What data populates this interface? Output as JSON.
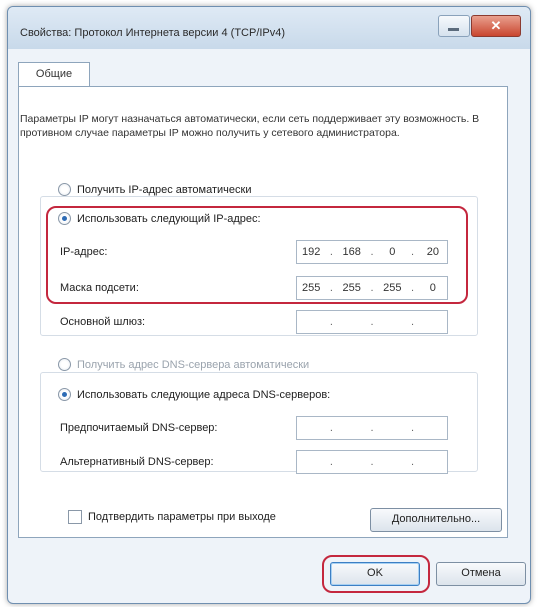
{
  "window": {
    "title": "Свойства: Протокол Интернета версии 4 (TCP/IPv4)",
    "close_glyph": "✕"
  },
  "tabs": [
    {
      "label": "Общие"
    }
  ],
  "description": "Параметры IP могут назначаться автоматически, если сеть поддерживает эту возможность. В противном случае параметры IP можно получить у сетевого администратора.",
  "ip_section": {
    "auto_label": "Получить IP-адрес автоматически",
    "manual_label": "Использовать следующий IP-адрес:",
    "ip_label": "IP-адрес:",
    "ip_value": [
      "192",
      "168",
      "0",
      "20"
    ],
    "mask_label": "Маска подсети:",
    "mask_value": [
      "255",
      "255",
      "255",
      "0"
    ],
    "gateway_label": "Основной шлюз:",
    "gateway_value": [
      "",
      "",
      "",
      ""
    ]
  },
  "dns_section": {
    "auto_label": "Получить адрес DNS-сервера автоматически",
    "manual_label": "Использовать следующие адреса DNS-серверов:",
    "preferred_label": "Предпочитаемый DNS-сервер:",
    "preferred_value": [
      "",
      "",
      "",
      ""
    ],
    "alternate_label": "Альтернативный DNS-сервер:",
    "alternate_value": [
      "",
      "",
      "",
      ""
    ]
  },
  "validate_checkbox_label": "Подтвердить параметры при выходе",
  "advanced_button": "Дополнительно...",
  "ok_button": "OK",
  "cancel_button": "Отмена",
  "colors": {
    "highlight": "#c4273e",
    "accent": "#2d6bb5"
  }
}
